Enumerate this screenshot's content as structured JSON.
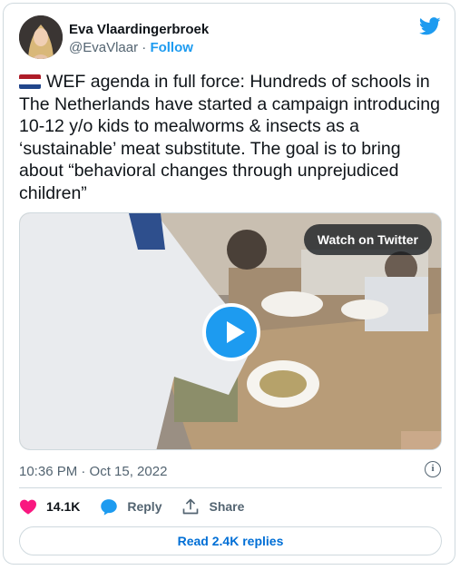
{
  "author": {
    "name": "Eva Vlaardingerbroek",
    "handle": "@EvaVlaar",
    "separator": "·",
    "follow_label": "Follow"
  },
  "tweet": {
    "flag": "netherlands-flag",
    "text": "WEF agenda in full force: Hundreds of schools in The Netherlands have started a campaign introducing 10-12 y/o kids to mealworms & insects as a ‘sustainable’ meat substitute. The goal is to bring about “behavioral changes through unprejudiced children”"
  },
  "media": {
    "watch_label": "Watch on Twitter",
    "play_icon": "play-icon"
  },
  "meta": {
    "timestamp": "10:36 PM · Oct 15, 2022",
    "info_icon": "info-icon"
  },
  "actions": {
    "likes": "14.1K",
    "reply_label": "Reply",
    "share_label": "Share"
  },
  "replies": {
    "label": "Read 2.4K replies"
  },
  "colors": {
    "brand": "#1d9bf0",
    "like": "#f91880",
    "link": "#006fd6",
    "muted": "#536471"
  }
}
